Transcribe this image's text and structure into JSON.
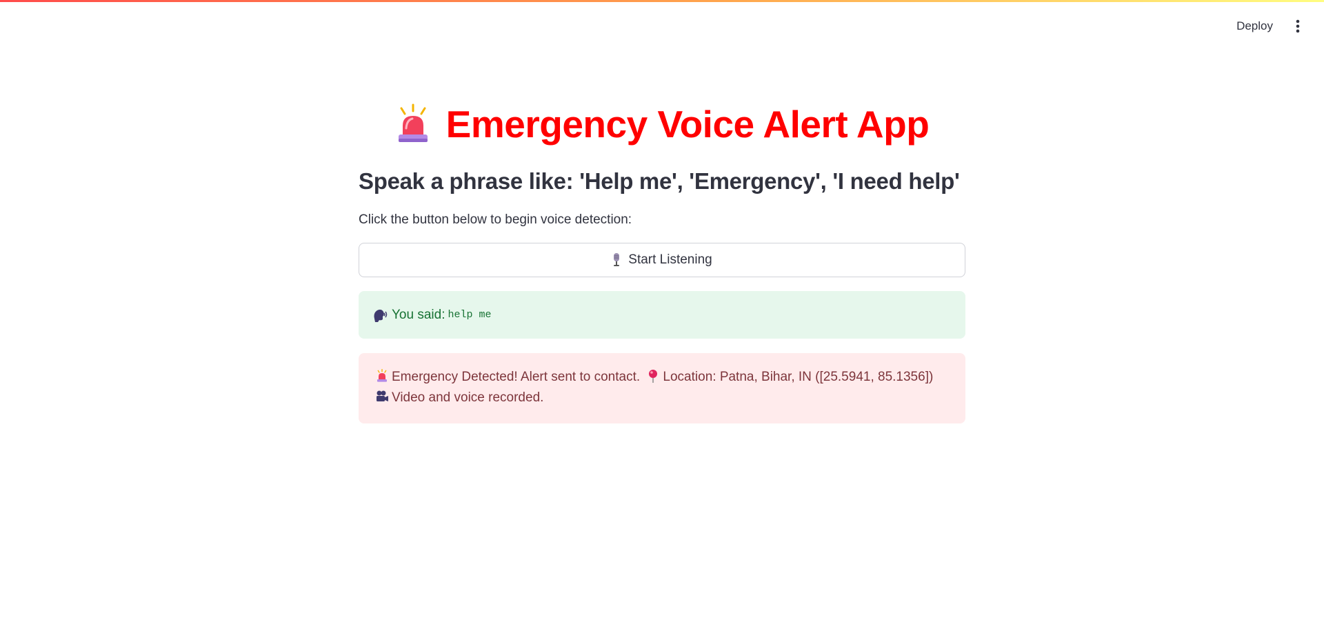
{
  "header": {
    "deploy_label": "Deploy",
    "menu_icon": "more-vertical-icon"
  },
  "main": {
    "title": "Emergency Voice Alert App",
    "title_icon": "police-siren-icon",
    "title_color": "#ff0000",
    "subtitle": "Speak a phrase like: 'Help me', 'Emergency', 'I need help'",
    "instruction": "Click the button below to begin voice detection:",
    "start_button": {
      "label": "Start Listening",
      "icon": "microphone-icon"
    },
    "success_alert": {
      "icon": "speaking-head-icon",
      "prefix": "You said:",
      "spoken_text": "help me"
    },
    "error_alert": {
      "part1": "Emergency Detected! Alert sent to contact.",
      "part2": "Location: Patna, Bihar, IN ([25.5941, 85.1356])",
      "part3": "Video and voice recorded.",
      "icons": [
        "police-siren-icon",
        "map-pin-icon",
        "video-camera-icon"
      ]
    }
  },
  "colors": {
    "accent": "#ff4b4b",
    "success_bg": "#e6f7ec",
    "success_text": "#177233",
    "error_bg": "#ffebec",
    "error_text": "#7d353b"
  }
}
